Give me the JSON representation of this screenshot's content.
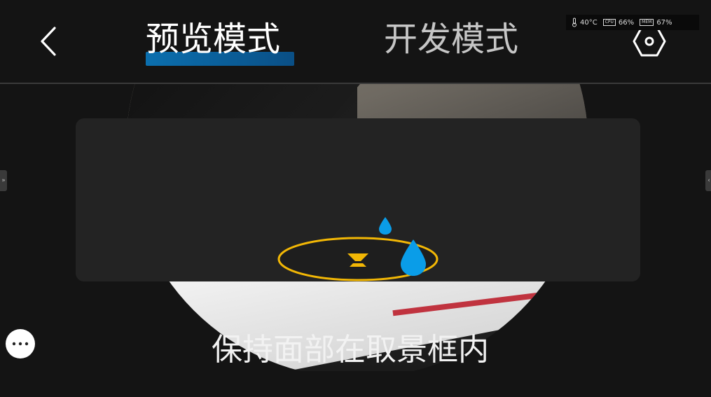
{
  "header": {
    "tabs": [
      {
        "label": "预览模式",
        "active": true
      },
      {
        "label": "开发模式",
        "active": false
      }
    ],
    "accent_color": "#0b6fae"
  },
  "status": {
    "temperature": "40°C",
    "cpu_label": "CPU",
    "cpu": "66%",
    "mem_label": "MEM",
    "mem": "67%"
  },
  "icons": {
    "back": "chevron-left-icon",
    "settings": "hexagon-settings-icon",
    "more": "more-dots-icon",
    "loader": "loading-bell-icon"
  },
  "loader_colors": {
    "ring": "#f2b705",
    "drop": "#0a9de8"
  },
  "side_handles": {
    "left": "»",
    "right": "‹"
  },
  "hint": "保持面部在取景框内"
}
